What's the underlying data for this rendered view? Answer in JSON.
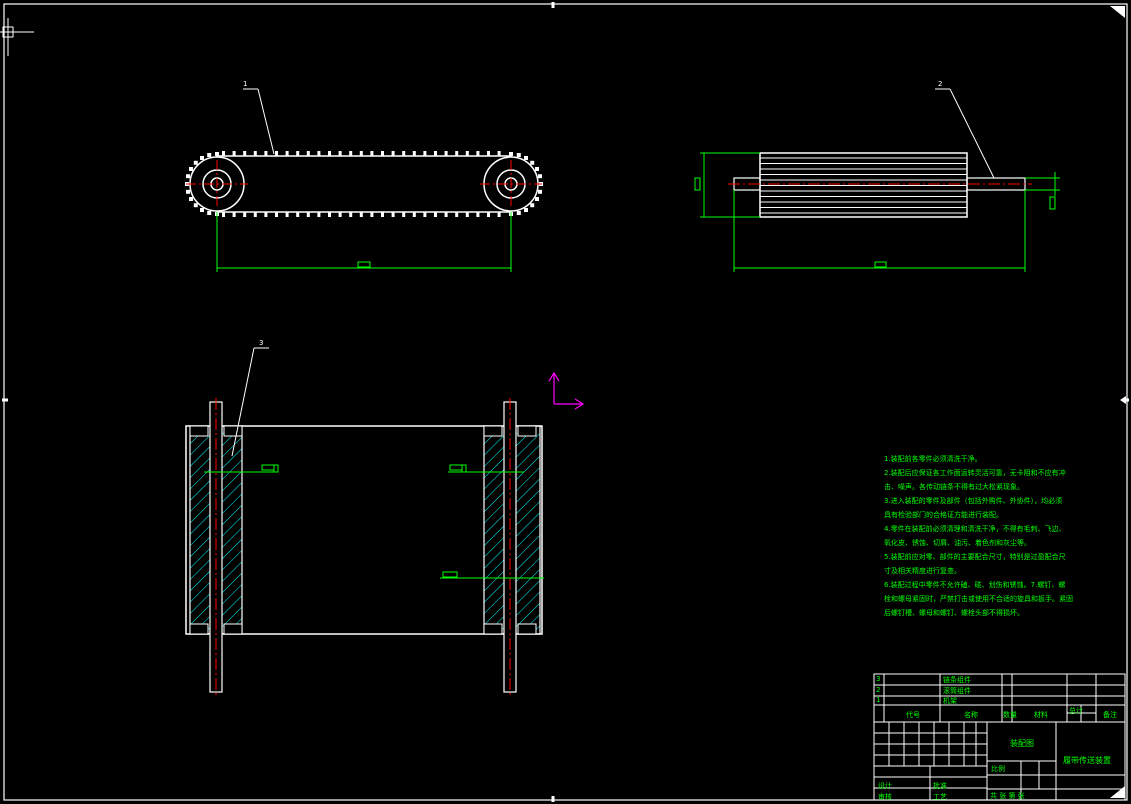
{
  "drawing": {
    "colors": {
      "background": "#000000",
      "outline": "#ffffff",
      "centerline": "#ff0000",
      "dimension": "#00ff00",
      "hatch": "#00ffff",
      "ucs": "#ff00ff",
      "notes": "#00ff00"
    },
    "callouts": [
      "1",
      "2",
      "3"
    ]
  },
  "notes": {
    "lines": [
      "1.装配前各零件必须清洗干净。",
      "2.装配后应保证各工作面运转灵活可靠，无卡阻和不应有冲",
      "击、噪声。各传动链条不得有过大松紧现象。",
      "3.进入装配的零件及部件（包括外购件、外协件），均必须",
      "具有检验部门的合格证方能进行装配。",
      "4.零件在装配前必须清理和清洗干净，不得有毛刺、飞边、",
      "氧化皮、锈蚀、切屑、油污、着色剂和灰尘等。",
      "5.装配前应对零、部件的主要配合尺寸，特别是过盈配合尺",
      "寸及相关精度进行复查。",
      "6.装配过程中零件不允许磕、碰、划伤和锈蚀。7.螺钉、螺",
      "栓和螺母紧固时，严禁打击或使用不合适的旋具和扳手。紧固",
      "后螺钉槽、螺母和螺钉、螺栓头部不得损坏。"
    ]
  },
  "title_block": {
    "header": {
      "code": "代号",
      "name": "名称",
      "qty": "数量",
      "material": "材料",
      "total": "总计",
      "remark": "备注"
    },
    "rows": [
      "链条组件",
      "滚筒组件",
      "机架"
    ],
    "row_index": [
      "3",
      "2",
      "1"
    ],
    "drawing_title": "履带传送装置",
    "assembly": "装配图",
    "designer": "设计",
    "checker": "审核",
    "process": "工艺",
    "approve": "批准",
    "scale": "比例",
    "sheet": "共 张 第 张"
  }
}
